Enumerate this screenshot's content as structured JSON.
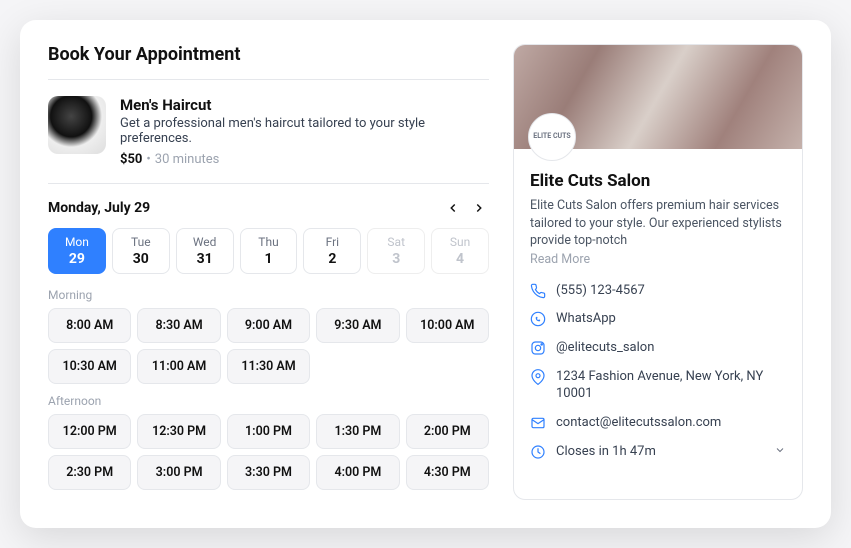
{
  "page_title": "Book Your Appointment",
  "service": {
    "title": "Men's Haircut",
    "description": "Get a professional men's haircut tailored to your style preferences.",
    "price": "$50",
    "duration": "30 minutes"
  },
  "date_header": "Monday, July 29",
  "days": [
    {
      "dow": "Mon",
      "num": "29",
      "selected": true,
      "disabled": false
    },
    {
      "dow": "Tue",
      "num": "30",
      "selected": false,
      "disabled": false
    },
    {
      "dow": "Wed",
      "num": "31",
      "selected": false,
      "disabled": false
    },
    {
      "dow": "Thu",
      "num": "1",
      "selected": false,
      "disabled": false
    },
    {
      "dow": "Fri",
      "num": "2",
      "selected": false,
      "disabled": false
    },
    {
      "dow": "Sat",
      "num": "3",
      "selected": false,
      "disabled": true
    },
    {
      "dow": "Sun",
      "num": "4",
      "selected": false,
      "disabled": true
    }
  ],
  "groups": [
    {
      "label": "Morning",
      "slots": [
        "8:00 AM",
        "8:30 AM",
        "9:00 AM",
        "9:30 AM",
        "10:00 AM",
        "10:30 AM",
        "11:00 AM",
        "11:30 AM"
      ]
    },
    {
      "label": "Afternoon",
      "slots": [
        "12:00 PM",
        "12:30 PM",
        "1:00 PM",
        "1:30 PM",
        "2:00 PM",
        "2:30 PM",
        "3:00 PM",
        "3:30 PM",
        "4:00 PM",
        "4:30 PM"
      ]
    }
  ],
  "salon": {
    "logo_text": "ELITE CUTS",
    "name": "Elite Cuts Salon",
    "description": "Elite Cuts Salon offers premium hair services tailored to your style. Our experienced stylists provide top-notch",
    "read_more": "Read More",
    "contacts": [
      {
        "icon": "phone",
        "text": "(555) 123-4567"
      },
      {
        "icon": "whatsapp",
        "text": "WhatsApp"
      },
      {
        "icon": "instagram",
        "text": "@elitecuts_salon"
      },
      {
        "icon": "location",
        "text": "1234 Fashion Avenue, New York, NY 10001"
      },
      {
        "icon": "email",
        "text": "contact@elitecutssalon.com"
      },
      {
        "icon": "clock",
        "text": "Closes in 1h 47m",
        "expandable": true
      }
    ]
  }
}
